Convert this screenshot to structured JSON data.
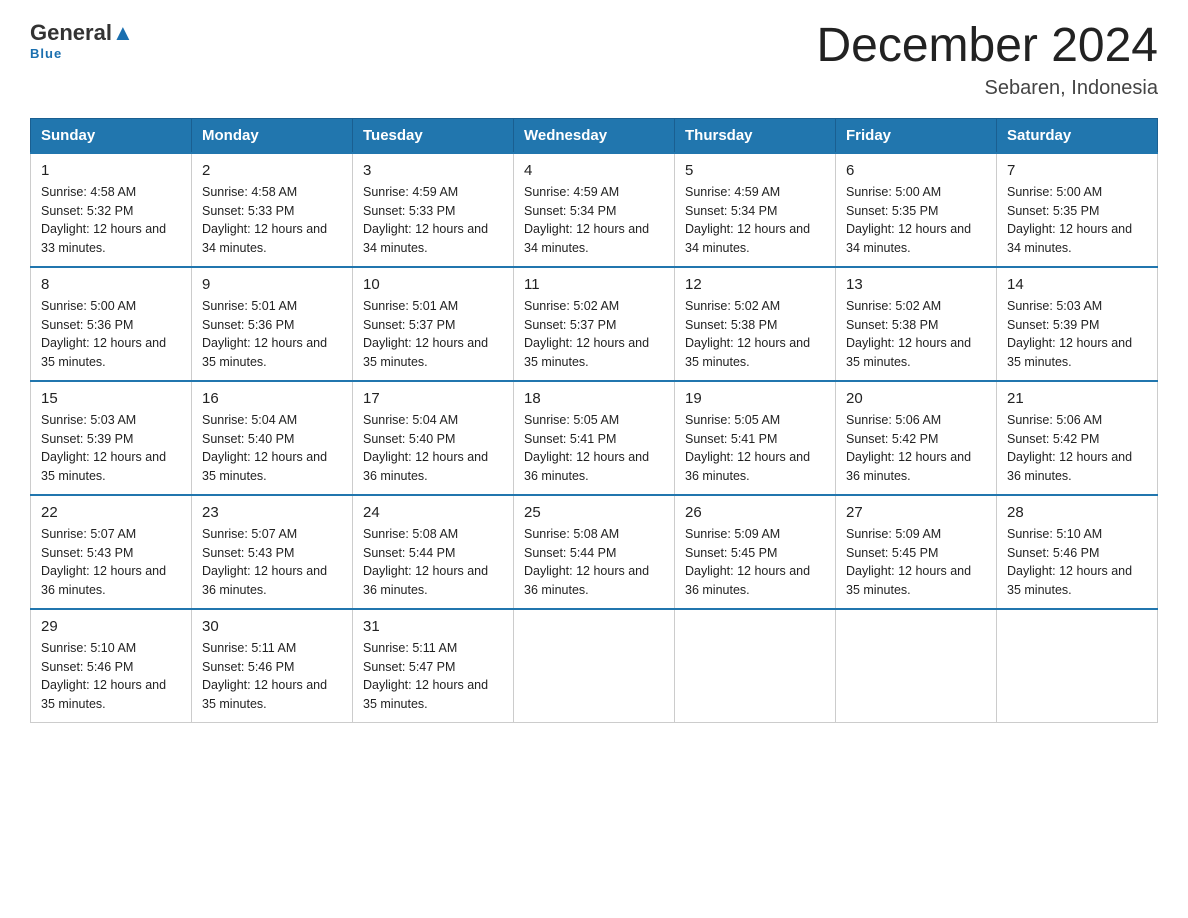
{
  "logo": {
    "general": "General",
    "blue": "Blue",
    "subtitle": "Blue"
  },
  "title": "December 2024",
  "location": "Sebaren, Indonesia",
  "days_of_week": [
    "Sunday",
    "Monday",
    "Tuesday",
    "Wednesday",
    "Thursday",
    "Friday",
    "Saturday"
  ],
  "weeks": [
    [
      {
        "day": "1",
        "sunrise": "4:58 AM",
        "sunset": "5:32 PM",
        "daylight": "12 hours and 33 minutes."
      },
      {
        "day": "2",
        "sunrise": "4:58 AM",
        "sunset": "5:33 PM",
        "daylight": "12 hours and 34 minutes."
      },
      {
        "day": "3",
        "sunrise": "4:59 AM",
        "sunset": "5:33 PM",
        "daylight": "12 hours and 34 minutes."
      },
      {
        "day": "4",
        "sunrise": "4:59 AM",
        "sunset": "5:34 PM",
        "daylight": "12 hours and 34 minutes."
      },
      {
        "day": "5",
        "sunrise": "4:59 AM",
        "sunset": "5:34 PM",
        "daylight": "12 hours and 34 minutes."
      },
      {
        "day": "6",
        "sunrise": "5:00 AM",
        "sunset": "5:35 PM",
        "daylight": "12 hours and 34 minutes."
      },
      {
        "day": "7",
        "sunrise": "5:00 AM",
        "sunset": "5:35 PM",
        "daylight": "12 hours and 34 minutes."
      }
    ],
    [
      {
        "day": "8",
        "sunrise": "5:00 AM",
        "sunset": "5:36 PM",
        "daylight": "12 hours and 35 minutes."
      },
      {
        "day": "9",
        "sunrise": "5:01 AM",
        "sunset": "5:36 PM",
        "daylight": "12 hours and 35 minutes."
      },
      {
        "day": "10",
        "sunrise": "5:01 AM",
        "sunset": "5:37 PM",
        "daylight": "12 hours and 35 minutes."
      },
      {
        "day": "11",
        "sunrise": "5:02 AM",
        "sunset": "5:37 PM",
        "daylight": "12 hours and 35 minutes."
      },
      {
        "day": "12",
        "sunrise": "5:02 AM",
        "sunset": "5:38 PM",
        "daylight": "12 hours and 35 minutes."
      },
      {
        "day": "13",
        "sunrise": "5:02 AM",
        "sunset": "5:38 PM",
        "daylight": "12 hours and 35 minutes."
      },
      {
        "day": "14",
        "sunrise": "5:03 AM",
        "sunset": "5:39 PM",
        "daylight": "12 hours and 35 minutes."
      }
    ],
    [
      {
        "day": "15",
        "sunrise": "5:03 AM",
        "sunset": "5:39 PM",
        "daylight": "12 hours and 35 minutes."
      },
      {
        "day": "16",
        "sunrise": "5:04 AM",
        "sunset": "5:40 PM",
        "daylight": "12 hours and 35 minutes."
      },
      {
        "day": "17",
        "sunrise": "5:04 AM",
        "sunset": "5:40 PM",
        "daylight": "12 hours and 36 minutes."
      },
      {
        "day": "18",
        "sunrise": "5:05 AM",
        "sunset": "5:41 PM",
        "daylight": "12 hours and 36 minutes."
      },
      {
        "day": "19",
        "sunrise": "5:05 AM",
        "sunset": "5:41 PM",
        "daylight": "12 hours and 36 minutes."
      },
      {
        "day": "20",
        "sunrise": "5:06 AM",
        "sunset": "5:42 PM",
        "daylight": "12 hours and 36 minutes."
      },
      {
        "day": "21",
        "sunrise": "5:06 AM",
        "sunset": "5:42 PM",
        "daylight": "12 hours and 36 minutes."
      }
    ],
    [
      {
        "day": "22",
        "sunrise": "5:07 AM",
        "sunset": "5:43 PM",
        "daylight": "12 hours and 36 minutes."
      },
      {
        "day": "23",
        "sunrise": "5:07 AM",
        "sunset": "5:43 PM",
        "daylight": "12 hours and 36 minutes."
      },
      {
        "day": "24",
        "sunrise": "5:08 AM",
        "sunset": "5:44 PM",
        "daylight": "12 hours and 36 minutes."
      },
      {
        "day": "25",
        "sunrise": "5:08 AM",
        "sunset": "5:44 PM",
        "daylight": "12 hours and 36 minutes."
      },
      {
        "day": "26",
        "sunrise": "5:09 AM",
        "sunset": "5:45 PM",
        "daylight": "12 hours and 36 minutes."
      },
      {
        "day": "27",
        "sunrise": "5:09 AM",
        "sunset": "5:45 PM",
        "daylight": "12 hours and 35 minutes."
      },
      {
        "day": "28",
        "sunrise": "5:10 AM",
        "sunset": "5:46 PM",
        "daylight": "12 hours and 35 minutes."
      }
    ],
    [
      {
        "day": "29",
        "sunrise": "5:10 AM",
        "sunset": "5:46 PM",
        "daylight": "12 hours and 35 minutes."
      },
      {
        "day": "30",
        "sunrise": "5:11 AM",
        "sunset": "5:46 PM",
        "daylight": "12 hours and 35 minutes."
      },
      {
        "day": "31",
        "sunrise": "5:11 AM",
        "sunset": "5:47 PM",
        "daylight": "12 hours and 35 minutes."
      },
      null,
      null,
      null,
      null
    ]
  ]
}
